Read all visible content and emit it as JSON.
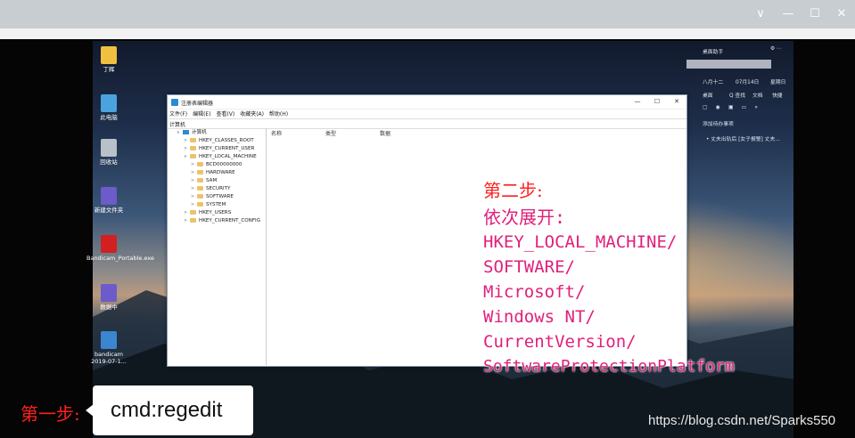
{
  "viewer": {
    "minimize": "—",
    "maximize": "☐",
    "close": "✕",
    "dropdown": "∨"
  },
  "desktop_icons": [
    {
      "label": "丁辉",
      "color": "#f0c040"
    },
    {
      "label": "此电脑",
      "color": "#4aa3df"
    },
    {
      "label": "回收站",
      "color": "#b8c0c8"
    },
    {
      "label": "新建文件夹",
      "color": "#6b5cc9"
    },
    {
      "label": "Bandicam_Portable.exe",
      "color": "#d22020"
    },
    {
      "label": "数据中",
      "color": "#6b5cc9"
    },
    {
      "label": "bandicam 2019-07-1...",
      "color": "#3a86d0"
    }
  ],
  "regedit": {
    "title": "注册表编辑器",
    "menu": [
      "文件(F)",
      "编辑(E)",
      "查看(V)",
      "收藏夹(A)",
      "帮助(H)"
    ],
    "address": "计算机",
    "tree": [
      {
        "label": "计算机",
        "level": 0,
        "arrow": "∨",
        "type": "pc"
      },
      {
        "label": "HKEY_CLASSES_ROOT",
        "level": 1,
        "arrow": ">",
        "type": "folder"
      },
      {
        "label": "HKEY_CURRENT_USER",
        "level": 1,
        "arrow": ">",
        "type": "folder"
      },
      {
        "label": "HKEY_LOCAL_MACHINE",
        "level": 1,
        "arrow": "∨",
        "type": "folder"
      },
      {
        "label": "BCD00000000",
        "level": 2,
        "arrow": ">",
        "type": "folder"
      },
      {
        "label": "HARDWARE",
        "level": 2,
        "arrow": ">",
        "type": "folder"
      },
      {
        "label": "SAM",
        "level": 2,
        "arrow": ">",
        "type": "folder"
      },
      {
        "label": "SECURITY",
        "level": 2,
        "arrow": ">",
        "type": "folder"
      },
      {
        "label": "SOFTWARE",
        "level": 2,
        "arrow": ">",
        "type": "folder"
      },
      {
        "label": "SYSTEM",
        "level": 2,
        "arrow": ">",
        "type": "folder"
      },
      {
        "label": "HKEY_USERS",
        "level": 1,
        "arrow": ">",
        "type": "folder"
      },
      {
        "label": "HKEY_CURRENT_CONFIG",
        "level": 1,
        "arrow": ">",
        "type": "folder"
      }
    ],
    "columns": [
      "名称",
      "类型",
      "数据"
    ]
  },
  "widget": {
    "title": "桌面助手",
    "lunar": "八月十二",
    "date": "07月14日",
    "weekday": "星期日",
    "tools": [
      "桌面",
      "Q 查找",
      "文档",
      "快捷"
    ],
    "add_todo": "添加待办事项",
    "news": "• 丈夫出轨后 [女子报警] 丈夫..."
  },
  "annotations": {
    "step1": "第一步:",
    "command": "cmd:regedit",
    "step2": "第二步:",
    "expand": "依次展开:",
    "path": [
      "HKEY_LOCAL_MACHINE/",
      "SOFTWARE/",
      "Microsoft/",
      "Windows NT/",
      "CurrentVersion/",
      "SoftwareProtectionPlatform"
    ]
  },
  "watermark": "https://blog.csdn.net/Sparks550",
  "colors": {
    "annotation_red": "#ff2020",
    "annotation_magenta": "#e0207a",
    "chrome": "#c8cdd2"
  }
}
